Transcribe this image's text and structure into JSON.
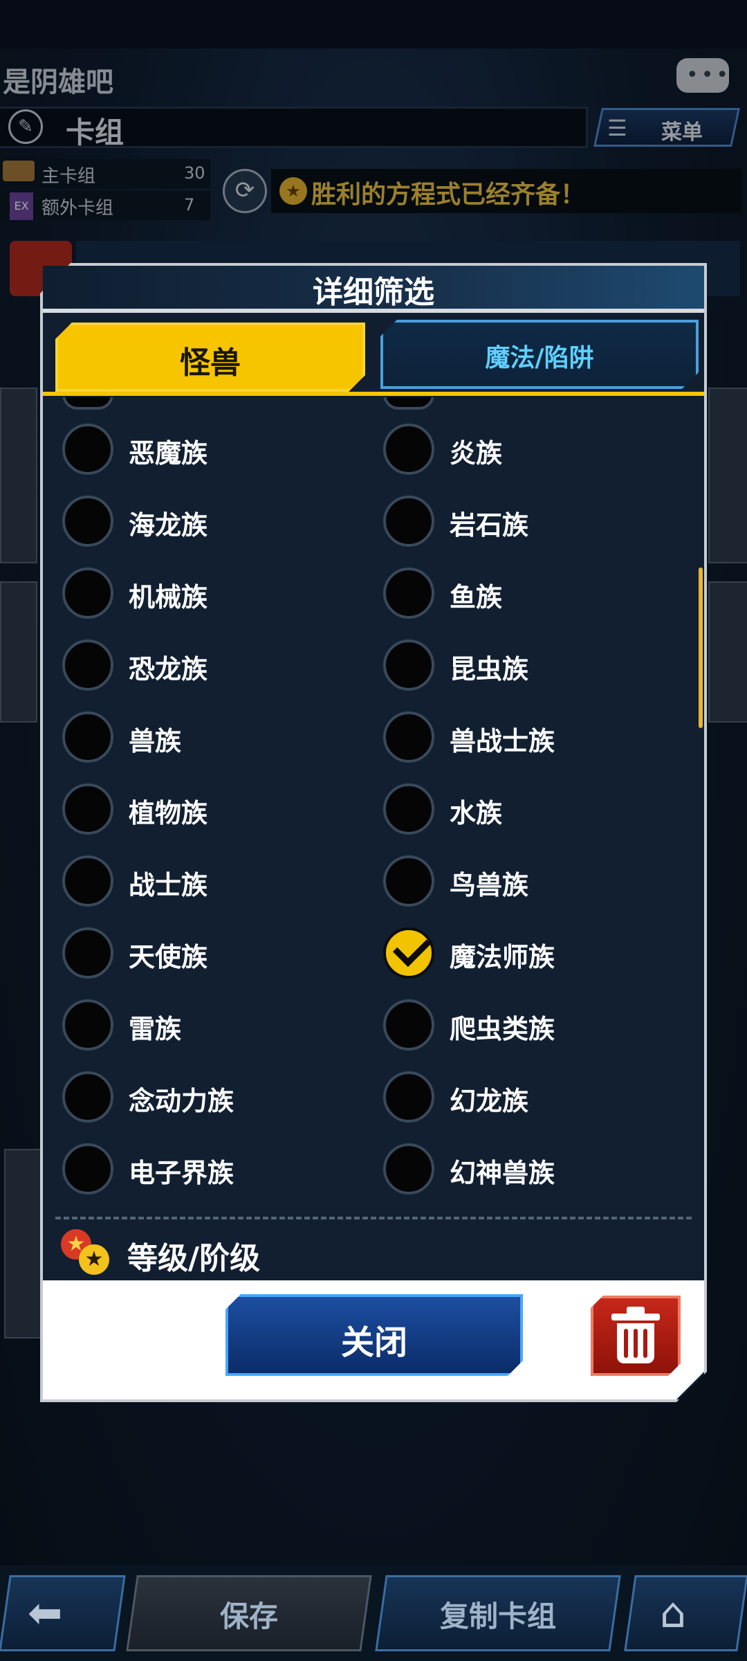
{
  "header": {
    "forum_name": "是阴雄吧",
    "deck_title": "卡组",
    "menu_label": "菜单",
    "main_deck_label": "主卡组",
    "main_deck_count": "30",
    "extra_icon": "EX",
    "extra_deck_label": "额外卡组",
    "extra_deck_count": "7",
    "banner_text": "胜利的方程式已经齐备！"
  },
  "dialog": {
    "title": "详细筛选",
    "tabs": [
      {
        "label": "怪兽",
        "active": true
      },
      {
        "label": "魔法/陷阱",
        "active": false
      }
    ],
    "races": [
      {
        "label": "恶魔族",
        "checked": false
      },
      {
        "label": "炎族",
        "checked": false
      },
      {
        "label": "海龙族",
        "checked": false
      },
      {
        "label": "岩石族",
        "checked": false
      },
      {
        "label": "机械族",
        "checked": false
      },
      {
        "label": "鱼族",
        "checked": false
      },
      {
        "label": "恐龙族",
        "checked": false
      },
      {
        "label": "昆虫族",
        "checked": false
      },
      {
        "label": "兽族",
        "checked": false
      },
      {
        "label": "兽战士族",
        "checked": false
      },
      {
        "label": "植物族",
        "checked": false
      },
      {
        "label": "水族",
        "checked": false
      },
      {
        "label": "战士族",
        "checked": false
      },
      {
        "label": "鸟兽族",
        "checked": false
      },
      {
        "label": "天使族",
        "checked": false
      },
      {
        "label": "魔法师族",
        "checked": true
      },
      {
        "label": "雷族",
        "checked": false
      },
      {
        "label": "爬虫类族",
        "checked": false
      },
      {
        "label": "念动力族",
        "checked": false
      },
      {
        "label": "幻龙族",
        "checked": false
      },
      {
        "label": "电子界族",
        "checked": false
      },
      {
        "label": "幻神兽族",
        "checked": false
      }
    ],
    "level_section_label": "等级/阶级",
    "close_label": "关闭"
  },
  "bottom": {
    "save_label": "保存",
    "copy_label": "复制卡组"
  },
  "colors": {
    "accent_yellow": "#f6c500",
    "tab_blue": "#5ed0ff",
    "close_blue": "#1d4ea0",
    "trash_red": "#c6281a"
  },
  "icons": [
    "chat-icon",
    "edit-icon",
    "menu-icon",
    "reload-icon",
    "star-icon",
    "check-icon",
    "level-stars-icon",
    "trash-icon",
    "back-arrow-icon",
    "home-icon"
  ]
}
